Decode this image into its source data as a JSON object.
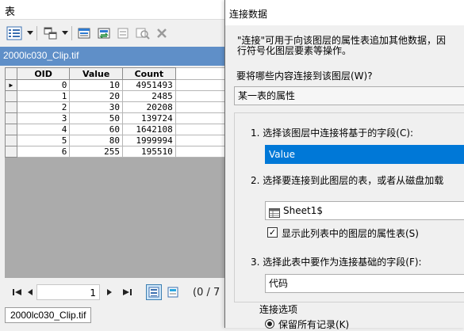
{
  "table_window": {
    "title": "表",
    "tab_name": "2000lc030_Clip.tif",
    "bottom_tab": "2000lc030_Clip.tif",
    "columns": [
      "OID",
      "Value",
      "Count"
    ],
    "rows": [
      [
        "0",
        "10",
        "4951493"
      ],
      [
        "1",
        "20",
        "2485"
      ],
      [
        "2",
        "30",
        "20208"
      ],
      [
        "3",
        "50",
        "139724"
      ],
      [
        "4",
        "60",
        "1642108"
      ],
      [
        "5",
        "80",
        "1999994"
      ],
      [
        "6",
        "255",
        "195510"
      ]
    ],
    "current_row_marker": "▶",
    "nav": {
      "first": "◀◀",
      "prev": "◀",
      "record": "1",
      "next": "▶",
      "last": "▶▶",
      "count_text": "(0 / 7"
    },
    "toolbar_icons": [
      "table-options-icon",
      "dropdown-arrow-icon",
      "related-tables-icon",
      "select-by-attributes-icon",
      "switch-selection-icon",
      "clear-selection-icon",
      "zoom-to-selected-icon",
      "delete-selected-icon"
    ]
  },
  "dialog": {
    "title": "连接数据",
    "description_line1": "\"连接\"可用于向该图层的属性表追加其他数据，因",
    "description_line2": "行符号化图层要素等操作。",
    "question": "要将哪些内容连接到该图层(W)?",
    "join_type": "某一表的属性",
    "step1_label": "1. 选择该图层中连接将基于的字段(C):",
    "step1_value": "Value",
    "step2_label": "2. 选择要连接到此图层的表，或者从磁盘加载",
    "step2_value": "Sheet1$",
    "show_attr_checkbox_label": "显示此列表中的图层的属性表(S)",
    "show_attr_checked": "✓",
    "step3_label": "3. 选择此表中要作为连接基础的字段(F):",
    "step3_value": "代码",
    "options_legend": "连接选项",
    "radio_keep_all": "保留所有记录(K)"
  }
}
